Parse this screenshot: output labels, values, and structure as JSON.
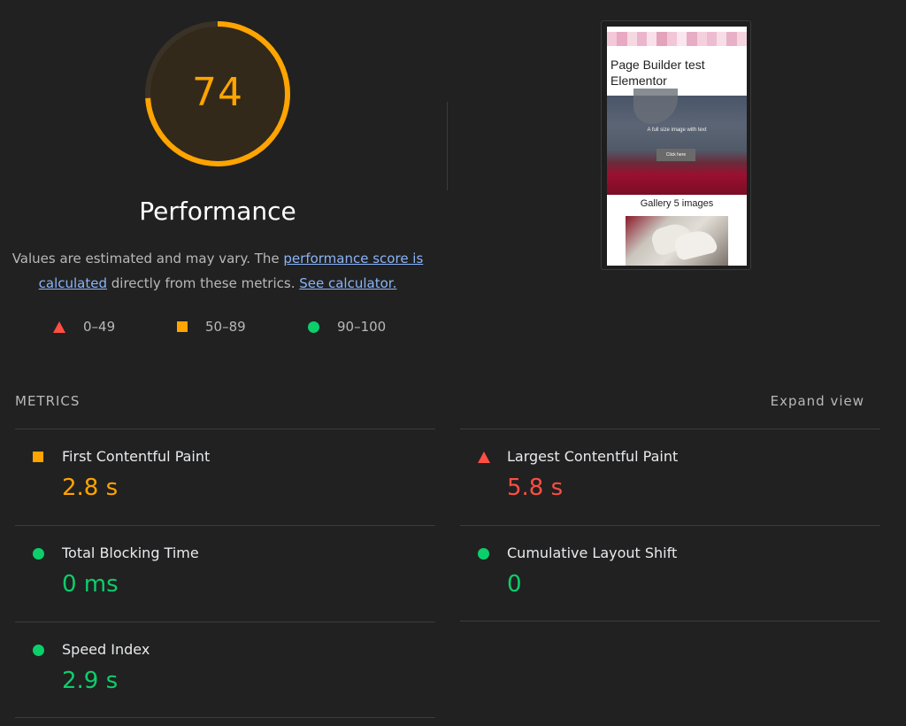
{
  "score": {
    "value": "74",
    "fraction": 0.74,
    "title": "Performance",
    "color": "#ffa400"
  },
  "description": {
    "prefix": "Values are estimated and may vary. The ",
    "link1": "performance score is calculated",
    "middle": " directly from these metrics. ",
    "link2": "See calculator."
  },
  "legend": [
    {
      "shape": "triangle-icon",
      "range": "0–49",
      "color": "#ff4e42"
    },
    {
      "shape": "square-icon",
      "range": "50–89",
      "color": "#ffa400"
    },
    {
      "shape": "circle-icon",
      "range": "90–100",
      "color": "#0cce6b"
    }
  ],
  "screenshot": {
    "title": "Page Builder test Elementor",
    "hero_text": "A full size image with text",
    "hero_button": "Click here",
    "gallery_title": "Gallery 5 images"
  },
  "metrics": {
    "header": "METRICS",
    "expand": "Expand view",
    "items": [
      {
        "label": "First Contentful Paint",
        "value": "2.8 s",
        "status": "average",
        "color": "#ffa400"
      },
      {
        "label": "Largest Contentful Paint",
        "value": "5.8 s",
        "status": "fail",
        "color": "#ff4e42"
      },
      {
        "label": "Total Blocking Time",
        "value": "0 ms",
        "status": "pass",
        "color": "#0cce6b"
      },
      {
        "label": "Cumulative Layout Shift",
        "value": "0",
        "status": "pass",
        "color": "#0cce6b"
      },
      {
        "label": "Speed Index",
        "value": "2.9 s",
        "status": "pass",
        "color": "#0cce6b"
      }
    ]
  }
}
